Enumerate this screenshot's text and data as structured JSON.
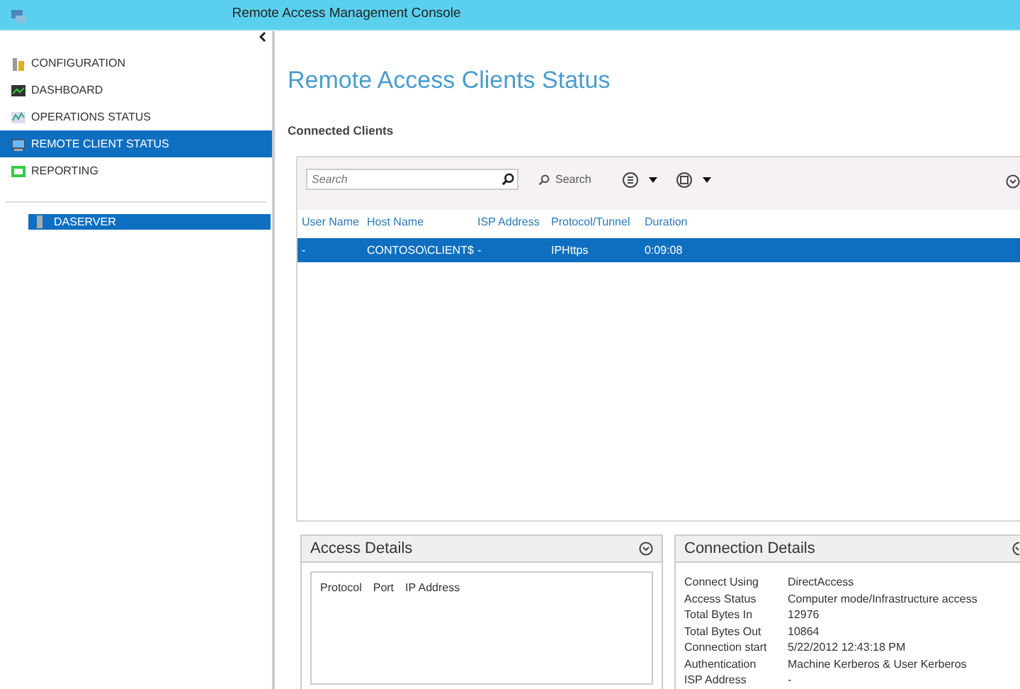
{
  "window": {
    "title": "Remote Access Management Console"
  },
  "sidebar": {
    "items": [
      {
        "label": "CONFIGURATION",
        "kind": "config",
        "selected": false
      },
      {
        "label": "DASHBOARD",
        "kind": "dashboard",
        "selected": false
      },
      {
        "label": "OPERATIONS STATUS",
        "kind": "operations",
        "selected": false
      },
      {
        "label": "REMOTE CLIENT STATUS",
        "kind": "client",
        "selected": true
      },
      {
        "label": "REPORTING",
        "kind": "reporting",
        "selected": false
      }
    ],
    "servers": [
      {
        "label": "DASERVER",
        "selected": true
      }
    ]
  },
  "page": {
    "heading": "Remote Access Clients Status",
    "section": "Connected Clients"
  },
  "toolbar": {
    "search_placeholder": "Search",
    "search_button": "Search"
  },
  "table": {
    "columns": [
      "User Name",
      "Host Name",
      "ISP Address",
      "Protocol/Tunnel",
      "Duration"
    ],
    "rows": [
      {
        "cells": [
          "-",
          "CONTOSO\\CLIENT$",
          "-",
          "IPHttps",
          "0:09:08"
        ],
        "selected": true
      }
    ]
  },
  "access_details": {
    "title": "Access Details",
    "columns": [
      "Protocol",
      "Port",
      "IP Address"
    ]
  },
  "connection_details": {
    "title": "Connection Details",
    "rows": [
      {
        "label": "Connect Using",
        "value": "DirectAccess"
      },
      {
        "label": "Access Status",
        "value": "Computer mode/Infrastructure access"
      },
      {
        "label": "Total Bytes In",
        "value": "12976"
      },
      {
        "label": "Total Bytes Out",
        "value": "10864"
      },
      {
        "label": "Connection start",
        "value": "5/22/2012 12:43:18 PM"
      },
      {
        "label": "Authentication",
        "value": "Machine Kerberos & User Kerberos"
      },
      {
        "label": "ISP Address",
        "value": "-"
      }
    ]
  }
}
